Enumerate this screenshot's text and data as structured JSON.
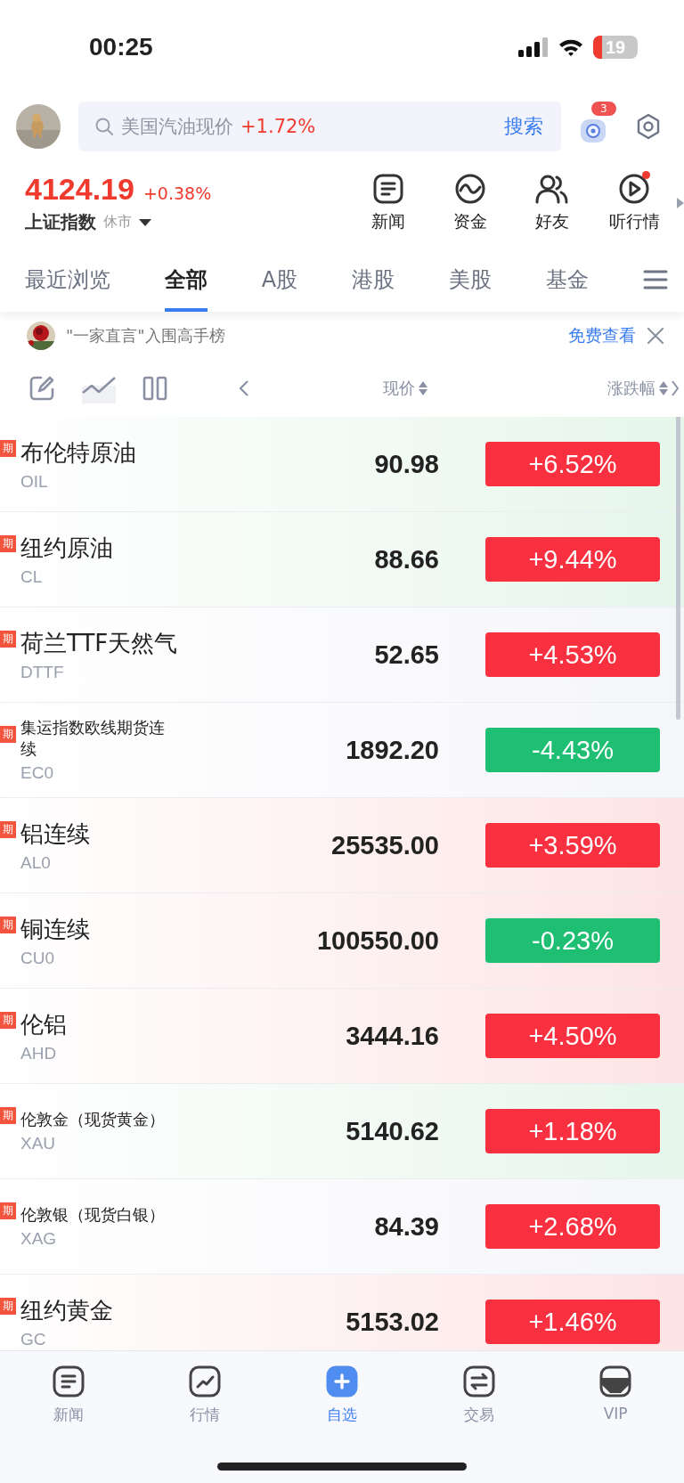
{
  "status_bar": {
    "time": "00:25",
    "battery": "19"
  },
  "header": {
    "search": {
      "placeholder": "美国汽油现价",
      "change": "+1.72%",
      "button": "搜索"
    },
    "notification_count": "3"
  },
  "index": {
    "value": "4124.19",
    "change": "+0.38%",
    "name": "上证指数",
    "status": "休市"
  },
  "shortcuts": [
    {
      "kind": "news",
      "label": "新闻",
      "dot": false
    },
    {
      "kind": "fund",
      "label": "资金",
      "dot": false
    },
    {
      "kind": "friends",
      "label": "好友",
      "dot": false
    },
    {
      "kind": "listen",
      "label": "听行情",
      "dot": true
    }
  ],
  "tabs": [
    {
      "label": "最近浏览",
      "selected": false
    },
    {
      "label": "全部",
      "selected": true
    },
    {
      "label": "A股",
      "selected": false
    },
    {
      "label": "港股",
      "selected": false
    },
    {
      "label": "美股",
      "selected": false
    },
    {
      "label": "基金",
      "selected": false
    }
  ],
  "banner": {
    "text": "\"一家直言\"入围高手榜",
    "link": "免费查看"
  },
  "columns": {
    "price": "现价",
    "change": "涨跌幅"
  },
  "rows": [
    {
      "tag": "期",
      "name": "布伦特原油",
      "code": "OIL",
      "price": "90.98",
      "change": "+6.52%",
      "rising": true,
      "color": "#e6f6eb",
      "small": false
    },
    {
      "tag": "期",
      "name": "纽约原油",
      "code": "CL",
      "price": "88.66",
      "change": "+9.44%",
      "rising": true,
      "color": "#e6f6eb",
      "small": false
    },
    {
      "tag": "期",
      "name": "荷兰TTF天然气",
      "code": "DTTF",
      "price": "52.65",
      "change": "+4.53%",
      "rising": true,
      "color": "#f5f6fa",
      "small": false
    },
    {
      "tag": "期",
      "name": "集运指数欧线期货连续",
      "code": "EC0",
      "price": "1892.20",
      "change": "-4.43%",
      "rising": false,
      "color": "#f5f6fa",
      "small": true
    },
    {
      "tag": "期",
      "name": "铝连续",
      "code": "AL0",
      "price": "25535.00",
      "change": "+3.59%",
      "rising": true,
      "color": "#fde4e4",
      "small": false
    },
    {
      "tag": "期",
      "name": "铜连续",
      "code": "CU0",
      "price": "100550.00",
      "change": "-0.23%",
      "rising": false,
      "color": "#fde4e4",
      "small": false
    },
    {
      "tag": "期",
      "name": "伦铝",
      "code": "AHD",
      "price": "3444.16",
      "change": "+4.50%",
      "rising": true,
      "color": "#fde4e4",
      "small": false
    },
    {
      "tag": "期",
      "name": "伦敦金（现货黄金）",
      "code": "XAU",
      "price": "5140.62",
      "change": "+1.18%",
      "rising": true,
      "color": "#e6f6eb",
      "small": true
    },
    {
      "tag": "期",
      "name": "伦敦银（现货白银）",
      "code": "XAG",
      "price": "84.39",
      "change": "+2.68%",
      "rising": true,
      "color": "#f5f6fa",
      "small": true
    },
    {
      "tag": "期",
      "name": "纽约黄金",
      "code": "GC",
      "price": "5153.02",
      "change": "+1.46%",
      "rising": true,
      "color": "#fde4e4",
      "small": false
    }
  ],
  "bottom_nav": [
    {
      "kind": "news",
      "label": "新闻",
      "selected": false
    },
    {
      "kind": "market",
      "label": "行情",
      "selected": false
    },
    {
      "kind": "watch",
      "label": "自选",
      "selected": true
    },
    {
      "kind": "trade",
      "label": "交易",
      "selected": false
    },
    {
      "kind": "vip",
      "label": "VIP",
      "selected": false
    }
  ]
}
